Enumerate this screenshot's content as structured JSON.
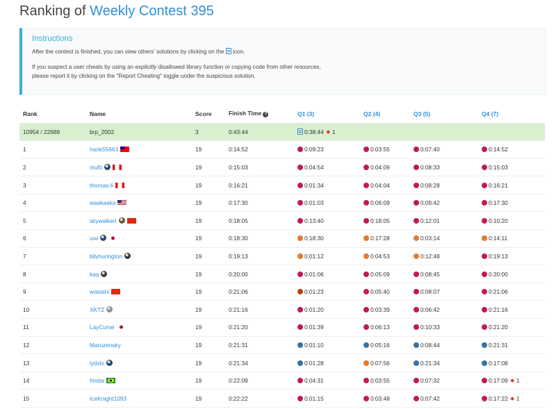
{
  "title": {
    "prefix": "Ranking of ",
    "contest": "Weekly Contest 395"
  },
  "instructions": {
    "heading": "Instructions",
    "line1_before": "After the contest is finished, you can view others' solutions by clicking on the",
    "line1_after": "icon.",
    "line2_a": "If you suspect a user cheats by using an ",
    "line2_em": "explicitly",
    "line2_b": " disallowed library function or copying code from other resources,",
    "line3": "please report it by clicking on the \"Report Cheating\" toggle under the suspicious solution."
  },
  "headers": {
    "rank": "Rank",
    "name": "Name",
    "score": "Score",
    "finish": "Finish Time",
    "q1": "Q1 (3)",
    "q2": "Q2 (4)",
    "q3": "Q3 (5)",
    "q4": "Q4 (7)"
  },
  "colors": {
    "accent": "#2f8ed8",
    "self_row": "#d8f0cf",
    "cpp": "#c2185b",
    "python": "#3572A5",
    "java": "#e57a2f",
    "rust": "#b7410e",
    "wrong": "#dd3333"
  },
  "rows": [
    {
      "rank": "10954 / 22688",
      "name": "brp_2002",
      "score": "3",
      "finish": "0:43:44",
      "self": true,
      "marks": [],
      "q": [
        {
          "lang": "doc",
          "time": "0:38:44",
          "bug": "1"
        },
        null,
        null,
        null
      ]
    },
    {
      "rank": "1",
      "name": "hank55663",
      "score": "19",
      "finish": "0:14:52",
      "marks": [
        {
          "type": "flag",
          "icon": "flag-tw-icon",
          "c1": "#fe0000",
          "c2": "#000095"
        }
      ],
      "q": [
        {
          "lang": "cpp",
          "time": "0:09:23"
        },
        {
          "lang": "cpp",
          "time": "0:03:55"
        },
        {
          "lang": "cpp",
          "time": "0:07:40"
        },
        {
          "lang": "cpp",
          "time": "0:14:52"
        }
      ]
    },
    {
      "rank": "2",
      "name": "mufti",
      "score": "19",
      "finish": "0:15:03",
      "marks": [
        {
          "type": "badge",
          "icon": "guardian-badge-icon",
          "c1": "#2b4a6f"
        },
        {
          "type": "flag",
          "icon": "flag-ca-icon",
          "c1": "#e3161a",
          "c2": "#ffffff"
        }
      ],
      "q": [
        {
          "lang": "cpp",
          "time": "0:04:54"
        },
        {
          "lang": "cpp",
          "time": "0:04:09"
        },
        {
          "lang": "cpp",
          "time": "0:08:33"
        },
        {
          "lang": "cpp",
          "time": "0:15:03"
        }
      ]
    },
    {
      "rank": "3",
      "name": "thomas-li",
      "score": "19",
      "finish": "0:16:21",
      "marks": [
        {
          "type": "flag",
          "icon": "flag-ca-icon",
          "c1": "#e3161a",
          "c2": "#ffffff"
        }
      ],
      "q": [
        {
          "lang": "cpp",
          "time": "0:01:34"
        },
        {
          "lang": "cpp",
          "time": "0:04:04"
        },
        {
          "lang": "cpp",
          "time": "0:08:28"
        },
        {
          "lang": "cpp",
          "time": "0:16:21"
        }
      ]
    },
    {
      "rank": "4",
      "name": "waakaaka",
      "score": "19",
      "finish": "0:17:30",
      "marks": [
        {
          "type": "flag",
          "icon": "flag-us-icon",
          "c1": "#b22234",
          "c2": "#3c3b6e"
        }
      ],
      "q": [
        {
          "lang": "cpp",
          "time": "0:01:03"
        },
        {
          "lang": "cpp",
          "time": "0:06:09"
        },
        {
          "lang": "cpp",
          "time": "0:09:42"
        },
        {
          "lang": "cpp",
          "time": "0:17:30"
        }
      ]
    },
    {
      "rank": "5",
      "name": "skywalkert",
      "score": "19",
      "finish": "0:18:05",
      "marks": [
        {
          "type": "badge",
          "icon": "knight-badge-icon",
          "c1": "#6b5a2a"
        },
        {
          "type": "flag",
          "icon": "flag-cn-icon",
          "c1": "#de2910",
          "c2": "#de2910"
        }
      ],
      "q": [
        {
          "lang": "cpp",
          "time": "0:13:40"
        },
        {
          "lang": "cpp",
          "time": "0:18:05"
        },
        {
          "lang": "cpp",
          "time": "0:12:01"
        },
        {
          "lang": "cpp",
          "time": "0:10:20"
        }
      ]
    },
    {
      "rank": "6",
      "name": "uwi",
      "score": "19",
      "finish": "0:18:30",
      "marks": [
        {
          "type": "badge",
          "icon": "guardian-badge-icon",
          "c1": "#2b4a6f"
        },
        {
          "type": "flag",
          "icon": "flag-jp-icon",
          "c1": "#ffffff",
          "c2": "#bc002d"
        }
      ],
      "q": [
        {
          "lang": "java",
          "time": "0:18:30"
        },
        {
          "lang": "java",
          "time": "0:17:28"
        },
        {
          "lang": "java",
          "time": "0:03:14"
        },
        {
          "lang": "java",
          "time": "0:14:11"
        }
      ]
    },
    {
      "rank": "7",
      "name": "bilyhurington",
      "score": "19",
      "finish": "0:19:13",
      "marks": [
        {
          "type": "badge",
          "icon": "knight-badge-icon",
          "c1": "#3a3a3a"
        }
      ],
      "q": [
        {
          "lang": "java",
          "time": "0:01:12"
        },
        {
          "lang": "java",
          "time": "0:04:53"
        },
        {
          "lang": "java",
          "time": "0:12:48"
        },
        {
          "lang": "cpp",
          "time": "0:19:13"
        }
      ]
    },
    {
      "rank": "8",
      "name": "kaq",
      "score": "19",
      "finish": "0:20:00",
      "marks": [
        {
          "type": "badge",
          "icon": "knight-badge-icon",
          "c1": "#3a3a3a"
        }
      ],
      "q": [
        {
          "lang": "cpp",
          "time": "0:01:06"
        },
        {
          "lang": "cpp",
          "time": "0:05:09"
        },
        {
          "lang": "cpp",
          "time": "0:08:45"
        },
        {
          "lang": "cpp",
          "time": "0:20:00"
        }
      ]
    },
    {
      "rank": "9",
      "name": "watashi",
      "score": "19",
      "finish": "0:21:06",
      "marks": [
        {
          "type": "flag",
          "icon": "flag-cn-icon",
          "c1": "#de2910",
          "c2": "#de2910"
        }
      ],
      "q": [
        {
          "lang": "rust",
          "time": "0:01:23"
        },
        {
          "lang": "cpp",
          "time": "0:05:40"
        },
        {
          "lang": "cpp",
          "time": "0:08:07"
        },
        {
          "lang": "cpp",
          "time": "0:21:06"
        }
      ]
    },
    {
      "rank": "10",
      "name": "XKTZ",
      "score": "19",
      "finish": "0:21:16",
      "marks": [
        {
          "type": "badge",
          "icon": "guardian-badge-icon",
          "c1": "#8a8f96"
        }
      ],
      "q": [
        {
          "lang": "cpp",
          "time": "0:01:20"
        },
        {
          "lang": "cpp",
          "time": "0:03:39"
        },
        {
          "lang": "cpp",
          "time": "0:06:42"
        },
        {
          "lang": "cpp",
          "time": "0:21:16"
        }
      ]
    },
    {
      "rank": "11",
      "name": "LayCurse",
      "score": "19",
      "finish": "0:21:20",
      "marks": [
        {
          "type": "flag",
          "icon": "flag-jp-icon",
          "c1": "#ffffff",
          "c2": "#bc002d"
        }
      ],
      "q": [
        {
          "lang": "cpp",
          "time": "0:01:39"
        },
        {
          "lang": "cpp",
          "time": "0:06:13"
        },
        {
          "lang": "cpp",
          "time": "0:10:33"
        },
        {
          "lang": "cpp",
          "time": "0:21:20"
        }
      ]
    },
    {
      "rank": "12",
      "name": "Maruzensky",
      "score": "19",
      "finish": "0:21:31",
      "marks": [],
      "q": [
        {
          "lang": "python",
          "time": "0:01:10"
        },
        {
          "lang": "python",
          "time": "0:05:16"
        },
        {
          "lang": "python",
          "time": "0:08:44"
        },
        {
          "lang": "python",
          "time": "0:21:31"
        }
      ]
    },
    {
      "rank": "13",
      "name": "lydxlx",
      "score": "19",
      "finish": "0:21:34",
      "marks": [
        {
          "type": "badge",
          "icon": "guardian-badge-icon",
          "c1": "#2b4a6f"
        }
      ],
      "q": [
        {
          "lang": "python",
          "time": "0:01:28"
        },
        {
          "lang": "java",
          "time": "0:07:56"
        },
        {
          "lang": "python",
          "time": "0:21:34"
        },
        {
          "lang": "python",
          "time": "0:17:08"
        }
      ]
    },
    {
      "rank": "14",
      "name": "fmota",
      "score": "19",
      "finish": "0:22:09",
      "marks": [
        {
          "type": "flag",
          "icon": "flag-br-icon",
          "c1": "#009c3b",
          "c2": "#ffdf00"
        }
      ],
      "q": [
        {
          "lang": "cpp",
          "time": "0:04:31"
        },
        {
          "lang": "cpp",
          "time": "0:03:55"
        },
        {
          "lang": "cpp",
          "time": "0:07:32"
        },
        {
          "lang": "cpp",
          "time": "0:17:09",
          "bug": "1"
        }
      ]
    },
    {
      "rank": "15",
      "name": "IceKnight1093",
      "score": "19",
      "finish": "0:22:22",
      "marks": [],
      "q": [
        {
          "lang": "cpp",
          "time": "0:01:15"
        },
        {
          "lang": "cpp",
          "time": "0:03:48"
        },
        {
          "lang": "cpp",
          "time": "0:07:42"
        },
        {
          "lang": "cpp",
          "time": "0:17:22",
          "bug": "1"
        }
      ]
    }
  ]
}
